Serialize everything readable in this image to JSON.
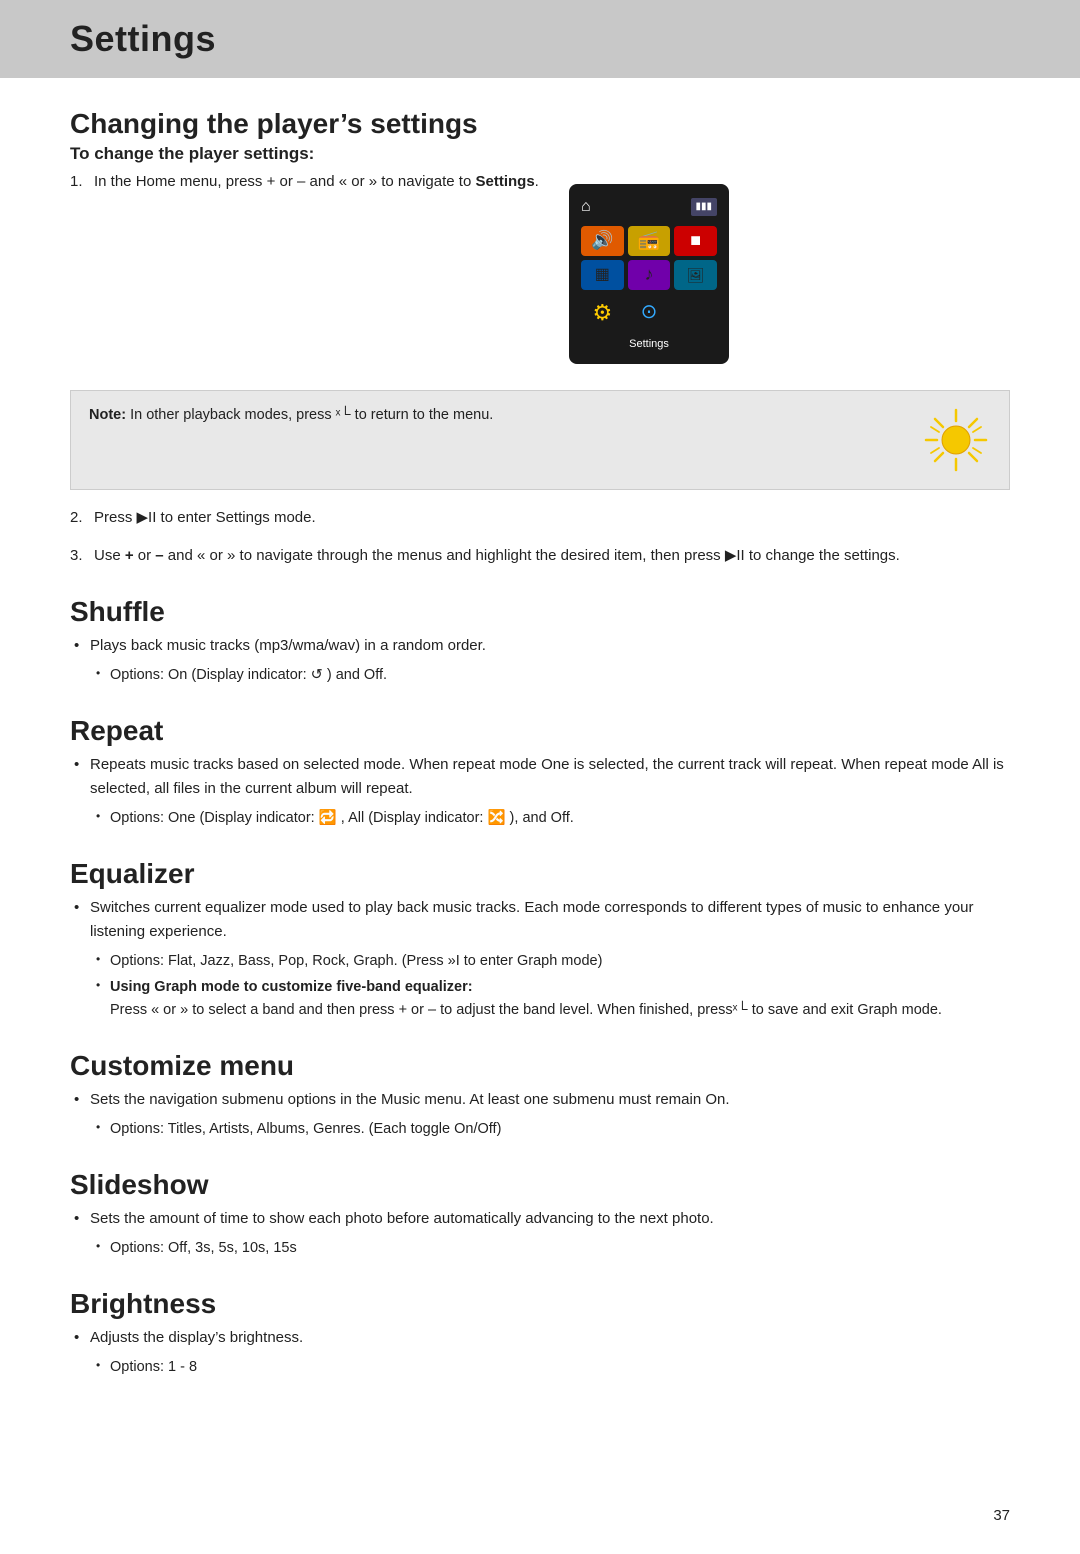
{
  "page": {
    "header": {
      "title": "Settings"
    },
    "page_number": "37"
  },
  "changing_player_settings": {
    "title": "Changing the player’s settings",
    "subtitle": "To change the player settings:",
    "steps": [
      {
        "id": 1,
        "text": "In the Home menu, press + or – and « or » to navigate to ",
        "bold_end": "Settings",
        "suffix": "."
      },
      {
        "id": 2,
        "text": "Press ⏮ to enter Settings mode."
      },
      {
        "id": 3,
        "text": "Use + or – and « or » to navigate through the menus and highlight the desired item, then press ⏮ to change the settings."
      }
    ],
    "note": {
      "prefix": "Note:",
      "text": " In other playback modes, press ˣ└ to return to the menu."
    },
    "device_label": "Settings"
  },
  "shuffle": {
    "title": "Shuffle",
    "bullet": "Plays back music tracks (mp3/wma/wav) in a random order.",
    "sub_bullet": "Options: On (Display indicator: ↺ ) and Off."
  },
  "repeat": {
    "title": "Repeat",
    "bullet": "Repeats music tracks based on selected mode. When repeat mode One is selected, the current track will repeat. When repeat mode All is selected, all files in the current album will repeat.",
    "sub_bullet": "Options: One (Display indicator: 🔁 , All (Display indicator: 🔀 ), and Off."
  },
  "equalizer": {
    "title": "Equalizer",
    "bullet": "Switches current equalizer mode used to play back music tracks. Each mode corresponds to different types of music to enhance your listening experience.",
    "sub_bullet1": "Options: Flat, Jazz, Bass, Pop, Rock, Graph. (Press »I to enter Graph mode)",
    "sub_bullet2_bold": "Using Graph mode to customize five-band equalizer:",
    "sub_bullet2_text": "Press « or » to select a band and then press + or – to adjust the band level. When finished, pressˣ└ to save and exit Graph mode."
  },
  "customize_menu": {
    "title": "Customize menu",
    "bullet": "Sets the navigation submenu options in the Music menu. At least one submenu must remain On.",
    "sub_bullet": "Options: Titles, Artists, Albums, Genres. (Each toggle On/Off)"
  },
  "slideshow": {
    "title": "Slideshow",
    "bullet": "Sets the amount of time to show each photo before automatically advancing to the next photo.",
    "sub_bullet": "Options: Off, 3s, 5s, 10s, 15s"
  },
  "brightness": {
    "title": "Brightness",
    "bullet": "Adjusts the display’s brightness.",
    "sub_bullet": "Options: 1 - 8"
  }
}
